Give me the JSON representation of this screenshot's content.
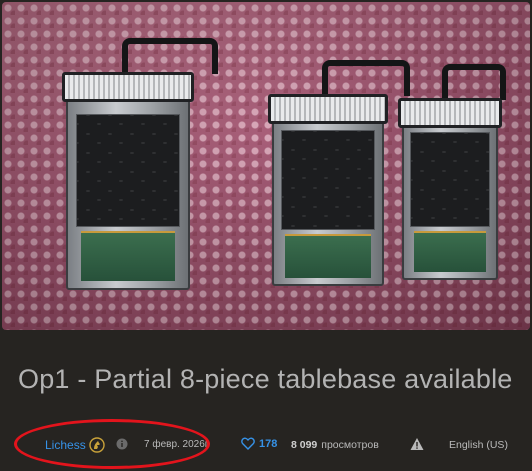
{
  "post": {
    "title": "Op1 - Partial 8-piece tablebase available",
    "image_alt": "Three hard drives in caddies on pink bubble wrap"
  },
  "meta": {
    "author": "Lichess",
    "author_icon": "lichess-knight-icon",
    "info_icon": "info-icon",
    "date": "7 февр. 2026г.",
    "likes": "178",
    "like_icon": "heart-icon",
    "views_count": "8 099",
    "views_label": "просмотров",
    "report_icon": "warning-icon",
    "language": "English (US)"
  },
  "colors": {
    "background": "#262421",
    "link": "#3692e7",
    "annotation": "#e3141c"
  }
}
